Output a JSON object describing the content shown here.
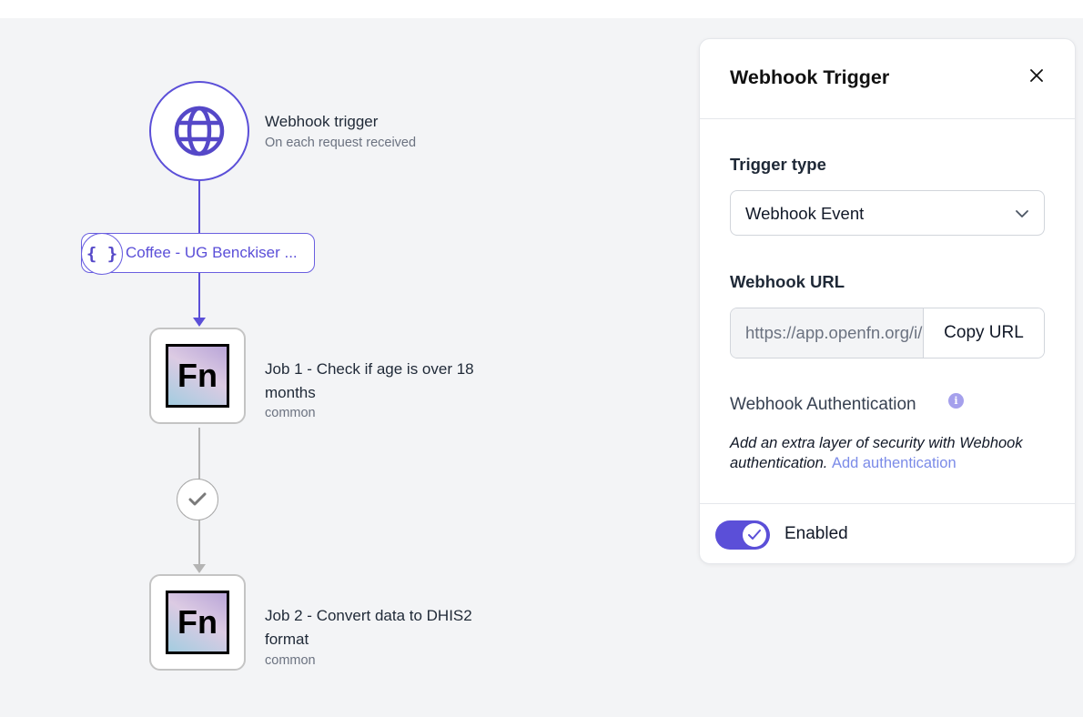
{
  "workflow": {
    "trigger": {
      "icon": "globe-icon",
      "title": "Webhook trigger",
      "subtitle": "On each request received"
    },
    "edge_label": {
      "icon": "braces-icon",
      "glyph": "{ }",
      "text": "Coffee - UG Benckiser ..."
    },
    "jobs": [
      {
        "logo": "Fn",
        "title_line1": "Job 1 - Check if age is over 18",
        "title_line2": "months",
        "adaptor": "common"
      },
      {
        "logo": "Fn",
        "title_line1": "Job 2 - Convert data to DHIS2",
        "title_line2": "format",
        "adaptor": "common"
      }
    ],
    "condition_icon": "checkmark-icon"
  },
  "panel": {
    "title": "Webhook Trigger",
    "close_icon": "close-icon",
    "trigger_type_label": "Trigger type",
    "trigger_type_value": "Webhook Event",
    "webhook_url_label": "Webhook URL",
    "webhook_url_value": "https://app.openfn.org/i/",
    "copy_button": "Copy URL",
    "auth_label": "Webhook Authentication",
    "auth_info_glyph": "i",
    "auth_description": "Add an extra layer of security with Webhook authentication.",
    "auth_link": "Add authentication",
    "enabled_label": "Enabled",
    "enabled": true
  },
  "colors": {
    "accent": "#5b4fd8",
    "canvas_bg": "#f3f4f6",
    "link": "#7b8be8"
  }
}
